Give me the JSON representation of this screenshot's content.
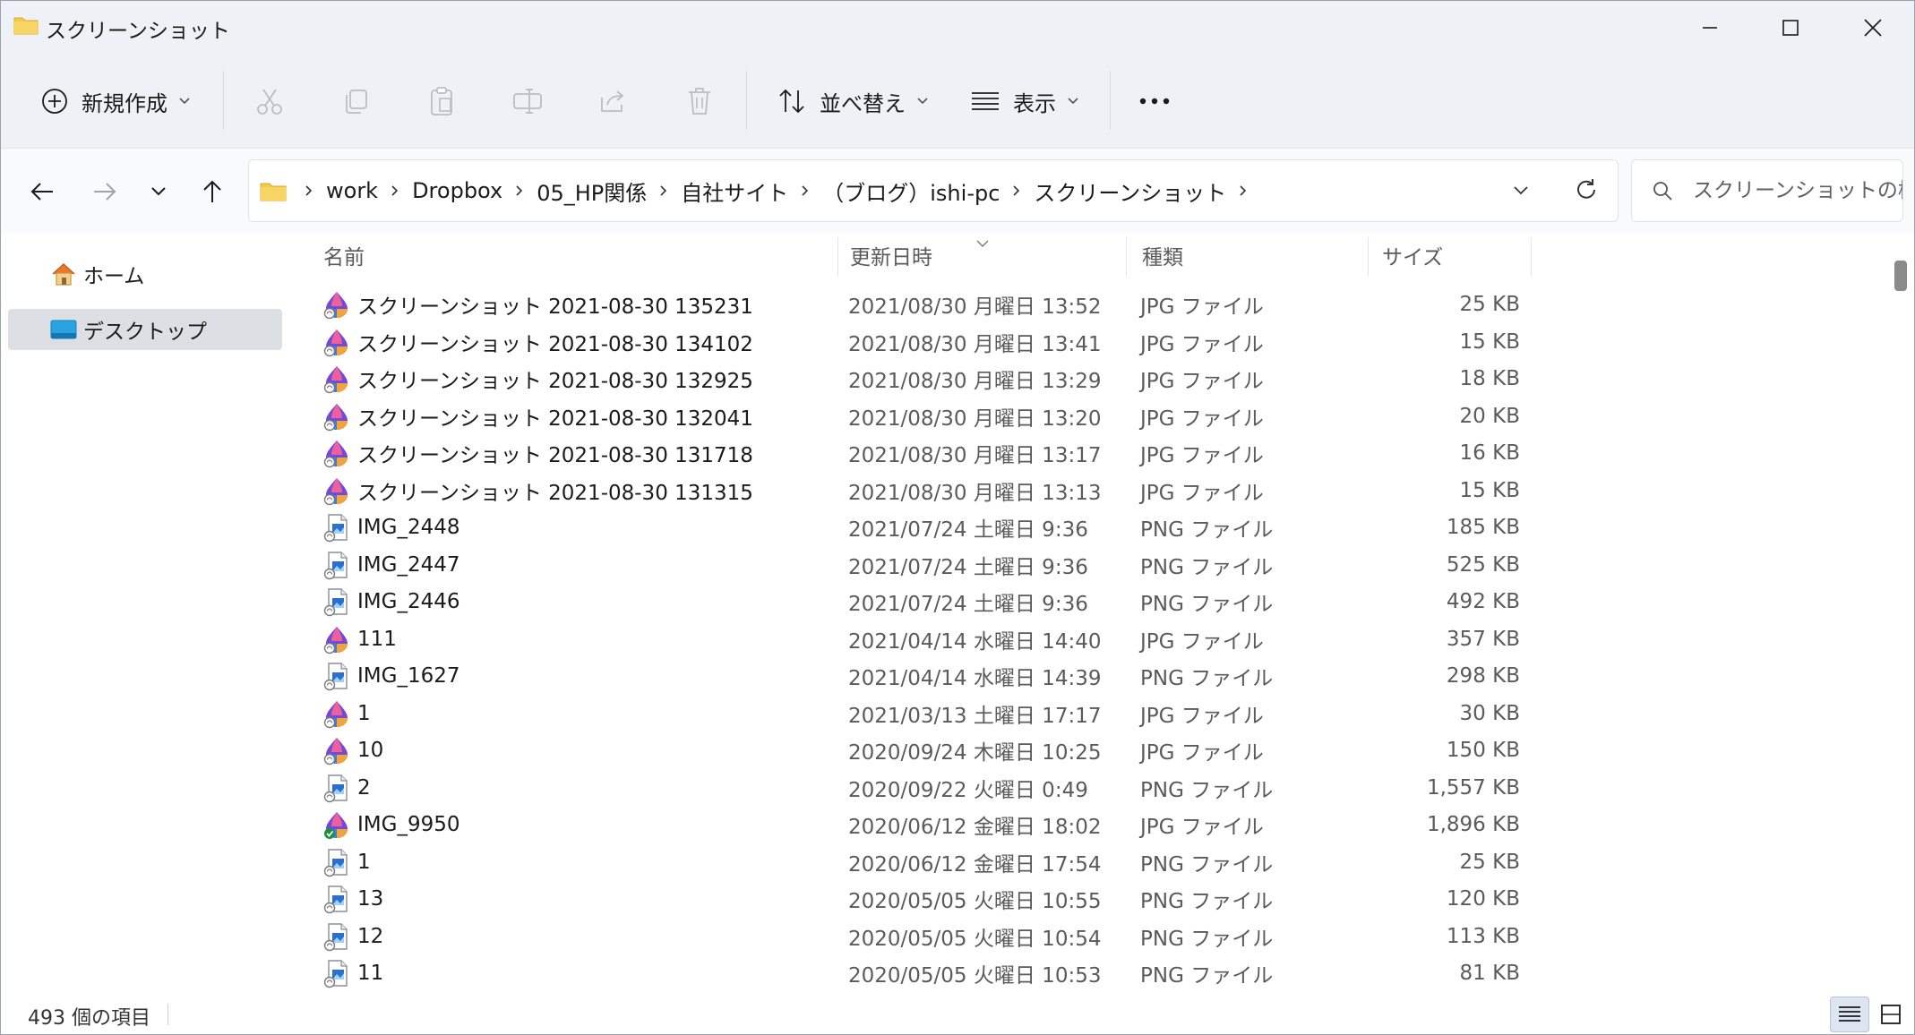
{
  "window": {
    "title": "スクリーンショット"
  },
  "toolbar": {
    "new_label": "新規作成",
    "sort_label": "並べ替え",
    "view_label": "表示"
  },
  "address": {
    "crumbs": [
      "work",
      "Dropbox",
      "05_HP関係",
      "自社サイト",
      "（ブログ）ishi-pc",
      "スクリーンショット"
    ]
  },
  "search": {
    "placeholder": "スクリーンショットの検索"
  },
  "sidebar": {
    "items": [
      {
        "label": "ホーム"
      },
      {
        "label": "デスクトップ"
      }
    ]
  },
  "columns": {
    "name": "名前",
    "date": "更新日時",
    "type": "種類",
    "size": "サイズ"
  },
  "files": [
    {
      "name": "スクリーンショット 2021-08-30 135231",
      "date": "2021/08/30 月曜日 13:52",
      "type": "JPG ファイル",
      "size": "25 KB",
      "icon": "photos-jpg-icon"
    },
    {
      "name": "スクリーンショット 2021-08-30 134102",
      "date": "2021/08/30 月曜日 13:41",
      "type": "JPG ファイル",
      "size": "15 KB",
      "icon": "photos-jpg-icon"
    },
    {
      "name": "スクリーンショット 2021-08-30 132925",
      "date": "2021/08/30 月曜日 13:29",
      "type": "JPG ファイル",
      "size": "18 KB",
      "icon": "photos-jpg-icon"
    },
    {
      "name": "スクリーンショット 2021-08-30 132041",
      "date": "2021/08/30 月曜日 13:20",
      "type": "JPG ファイル",
      "size": "20 KB",
      "icon": "photos-jpg-icon"
    },
    {
      "name": "スクリーンショット 2021-08-30 131718",
      "date": "2021/08/30 月曜日 13:17",
      "type": "JPG ファイル",
      "size": "16 KB",
      "icon": "photos-jpg-icon"
    },
    {
      "name": "スクリーンショット 2021-08-30 131315",
      "date": "2021/08/30 月曜日 13:13",
      "type": "JPG ファイル",
      "size": "15 KB",
      "icon": "photos-jpg-icon"
    },
    {
      "name": "IMG_2448",
      "date": "2021/07/24 土曜日 9:36",
      "type": "PNG ファイル",
      "size": "185 KB",
      "icon": "png-image-icon"
    },
    {
      "name": "IMG_2447",
      "date": "2021/07/24 土曜日 9:36",
      "type": "PNG ファイル",
      "size": "525 KB",
      "icon": "png-image-icon"
    },
    {
      "name": "IMG_2446",
      "date": "2021/07/24 土曜日 9:36",
      "type": "PNG ファイル",
      "size": "492 KB",
      "icon": "png-image-icon"
    },
    {
      "name": "111",
      "date": "2021/04/14 水曜日 14:40",
      "type": "JPG ファイル",
      "size": "357 KB",
      "icon": "photos-jpg-icon"
    },
    {
      "name": "IMG_1627",
      "date": "2021/04/14 水曜日 14:39",
      "type": "PNG ファイル",
      "size": "298 KB",
      "icon": "png-image-icon"
    },
    {
      "name": "1",
      "date": "2021/03/13 土曜日 17:17",
      "type": "JPG ファイル",
      "size": "30 KB",
      "icon": "photos-jpg-icon"
    },
    {
      "name": "10",
      "date": "2020/09/24 木曜日 10:25",
      "type": "JPG ファイル",
      "size": "150 KB",
      "icon": "photos-jpg-icon"
    },
    {
      "name": "2",
      "date": "2020/09/22 火曜日 0:49",
      "type": "PNG ファイル",
      "size": "1,557 KB",
      "icon": "png-image-icon"
    },
    {
      "name": "IMG_9950",
      "date": "2020/06/12 金曜日 18:02",
      "type": "JPG ファイル",
      "size": "1,896 KB",
      "icon": "photos-jpg-synced-icon"
    },
    {
      "name": "1",
      "date": "2020/06/12 金曜日 17:54",
      "type": "PNG ファイル",
      "size": "25 KB",
      "icon": "png-image-icon"
    },
    {
      "name": "13",
      "date": "2020/05/05 火曜日 10:55",
      "type": "PNG ファイル",
      "size": "120 KB",
      "icon": "png-image-icon"
    },
    {
      "name": "12",
      "date": "2020/05/05 火曜日 10:54",
      "type": "PNG ファイル",
      "size": "113 KB",
      "icon": "png-image-icon"
    },
    {
      "name": "11",
      "date": "2020/05/05 火曜日 10:53",
      "type": "PNG ファイル",
      "size": "81 KB",
      "icon": "png-image-icon"
    }
  ],
  "status": {
    "item_count": "493 個の項目"
  },
  "colors": {
    "accent": "#0067c0",
    "selected_bg": "#dcdfe3",
    "folder": "#f2c94c"
  }
}
